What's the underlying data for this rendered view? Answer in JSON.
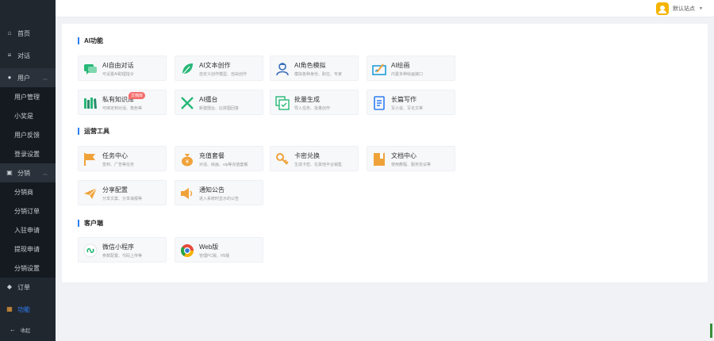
{
  "sidebar": {
    "items": [
      {
        "label": "首页",
        "icon": "home-icon"
      },
      {
        "label": "对话",
        "icon": "list-icon"
      },
      {
        "label": "用户",
        "icon": "user-icon"
      },
      {
        "label": "分销",
        "icon": "share-icon"
      },
      {
        "label": "订单",
        "icon": "order-icon"
      },
      {
        "label": "功能",
        "icon": "grid-icon"
      },
      {
        "label": "收起",
        "icon": "collapse-icon"
      }
    ],
    "user_sub": [
      "用户管理",
      "小奖是",
      "用户反馈",
      "登录设置"
    ],
    "dist_sub": [
      "分销商",
      "分销订单",
      "入驻申请",
      "提现申请",
      "分销设置"
    ],
    "accent": "#2f7ef5"
  },
  "header": {
    "user_name": "默认站点"
  },
  "sections": [
    {
      "title": "AI功能",
      "cards": [
        {
          "title": "AI自由对话",
          "desc": "可设置AI助理指令",
          "icon": "chat-icon",
          "color": "#27b877"
        },
        {
          "title": "AI文本创作",
          "desc": "自定义创作模型、自由创作",
          "icon": "leaf-icon",
          "color": "#27b877"
        },
        {
          "title": "AI角色模拟",
          "desc": "模拟各种身份、职位、专家",
          "icon": "person-icon",
          "color": "#3a6fb8"
        },
        {
          "title": "AI绘画",
          "desc": "内置多种绘画接口",
          "icon": "paint-icon",
          "color": "#1f9fd8"
        },
        {
          "title": "私有知识库",
          "desc": "可绑定到对话、角色等",
          "icon": "books-icon",
          "color": "#27b877",
          "badge": "文档库"
        },
        {
          "title": "AI擂台",
          "desc": "新建擂台、比拼图回答",
          "icon": "swords-icon",
          "color": "#27b877"
        },
        {
          "title": "批量生成",
          "desc": "导入任务、批量创作",
          "icon": "batch-icon",
          "color": "#27b877"
        },
        {
          "title": "长篇写作",
          "desc": "写小说、写论文等",
          "icon": "document-icon",
          "color": "#2f7ef5"
        }
      ]
    },
    {
      "title": "运营工具",
      "cards": [
        {
          "title": "任务中心",
          "desc": "签到、广告等任务",
          "icon": "flag-icon",
          "color": "#f0a23a"
        },
        {
          "title": "充值套餐",
          "desc": "对话、绘画、vip等充值套餐",
          "icon": "money-bag-icon",
          "color": "#f0a23a"
        },
        {
          "title": "卡密兑换",
          "desc": "生成卡密、在其他平台销售",
          "icon": "key-icon",
          "color": "#f0a23a"
        },
        {
          "title": "文档中心",
          "desc": "使用教程、服务协议等",
          "icon": "doc-center-icon",
          "color": "#f0a23a"
        },
        {
          "title": "分享配置",
          "desc": "分享文案、分享海报等",
          "icon": "paper-plane-icon",
          "color": "#f0a23a"
        },
        {
          "title": "通知公告",
          "desc": "进入系统时显示的公告",
          "icon": "speaker-icon",
          "color": "#f0a23a"
        }
      ]
    },
    {
      "title": "客户端",
      "cards": [
        {
          "title": "微信小程序",
          "desc": "参数配置、代码上传等",
          "icon": "miniprogram-icon",
          "color": "#27b877"
        },
        {
          "title": "Web版",
          "desc": "管理PC版、H5版",
          "icon": "chrome-icon",
          "color": "#e64a3c"
        }
      ]
    }
  ]
}
